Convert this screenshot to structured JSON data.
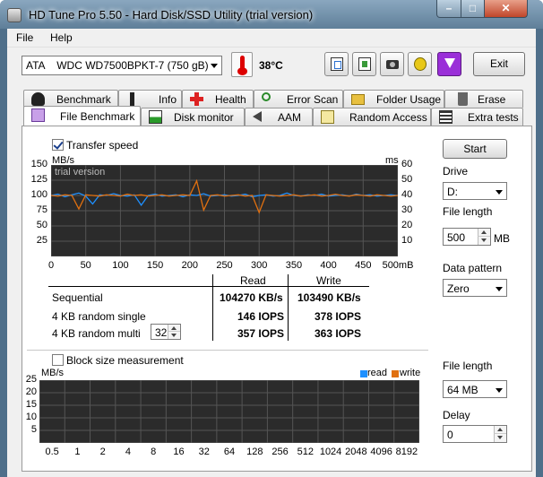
{
  "window": {
    "title": "HD Tune Pro 5.50 - Hard Disk/SSD Utility (trial version)"
  },
  "menu": [
    "File",
    "Help"
  ],
  "toolbar": {
    "drive": "ATA    WDC WD7500BPKT-7 (750 gB)",
    "temperature": "38°C",
    "exit_label": "Exit",
    "icons": [
      "copy-icon",
      "copy-all-icon",
      "camera-icon",
      "options-icon",
      "download-icon"
    ]
  },
  "tabs_row1": [
    "Benchmark",
    "Info",
    "Health",
    "Error Scan",
    "Folder Usage",
    "Erase"
  ],
  "tabs_row2": [
    "File Benchmark",
    "Disk monitor",
    "AAM",
    "Random Access",
    "Extra tests"
  ],
  "file_benchmark": {
    "transfer_speed_label": "Transfer speed",
    "transfer_speed_checked": true,
    "start_label": "Start",
    "drive_label": "Drive",
    "drive_value": "D:",
    "file_length_label": "File length",
    "file_length_value": "500",
    "file_length_unit": "MB",
    "data_pattern_label": "Data pattern",
    "data_pattern_value": "Zero",
    "results": {
      "col_read": "Read",
      "col_write": "Write",
      "rows": [
        {
          "label": "Sequential",
          "read": "104270 KB/s",
          "write": "103490 KB/s"
        },
        {
          "label": "4 KB random single",
          "read": "146 IOPS",
          "write": "378 IOPS"
        },
        {
          "label": "4 KB random multi",
          "read": "357 IOPS",
          "write": "363 IOPS"
        }
      ],
      "queue_depth": "32"
    },
    "block_size_label": "Block size measurement",
    "block_size_checked": false,
    "file_length2_label": "File length",
    "file_length2_value": "64 MB",
    "delay_label": "Delay",
    "delay_value": "0"
  },
  "chart_data": [
    {
      "type": "line",
      "watermark": "trial version",
      "ylabel_left": "MB/s",
      "ylabel_right": "ms",
      "ylim_left": [
        0,
        150
      ],
      "ylim_right": [
        0,
        60
      ],
      "yticks_left": [
        "150",
        "125",
        "100",
        "75",
        "50",
        "25"
      ],
      "yticks_right": [
        "60",
        "50",
        "40",
        "30",
        "20",
        "10"
      ],
      "xlim": [
        0,
        500
      ],
      "xticks": [
        "0",
        "50",
        "100",
        "150",
        "200",
        "250",
        "300",
        "350",
        "400",
        "450",
        "500mB"
      ],
      "grid": true,
      "series": [
        {
          "color": "#1e90ff",
          "x": [
            0,
            10,
            20,
            30,
            40,
            50,
            60,
            70,
            80,
            90,
            100,
            110,
            120,
            130,
            140,
            150,
            160,
            170,
            180,
            190,
            200,
            210,
            220,
            230,
            240,
            250,
            260,
            270,
            280,
            290,
            300,
            310,
            320,
            330,
            340,
            350,
            360,
            370,
            380,
            390,
            400,
            410,
            420,
            430,
            440,
            450,
            460,
            470,
            480,
            490,
            500
          ],
          "y": [
            100,
            102,
            98,
            101,
            104,
            99,
            86,
            101,
            100,
            103,
            100,
            99,
            101,
            84,
            100,
            102,
            99,
            100,
            101,
            98,
            101,
            100,
            103,
            99,
            100,
            101,
            99,
            100,
            102,
            98,
            100,
            101,
            99,
            100,
            104,
            100,
            99,
            101,
            100,
            102,
            99,
            100,
            101,
            99,
            102,
            100,
            101,
            99,
            100,
            101,
            100
          ]
        },
        {
          "color": "#e07010",
          "x": [
            0,
            10,
            20,
            30,
            40,
            50,
            60,
            70,
            80,
            90,
            100,
            110,
            120,
            130,
            140,
            150,
            160,
            170,
            180,
            190,
            200,
            210,
            220,
            230,
            240,
            250,
            260,
            270,
            280,
            290,
            300,
            310,
            320,
            330,
            340,
            350,
            360,
            370,
            380,
            390,
            400,
            410,
            420,
            430,
            440,
            450,
            460,
            470,
            480,
            490,
            500
          ],
          "y": [
            100,
            99,
            101,
            100,
            78,
            101,
            100,
            99,
            101,
            100,
            99,
            102,
            100,
            101,
            99,
            100,
            101,
            99,
            100,
            101,
            100,
            124,
            76,
            100,
            101,
            99,
            100,
            101,
            99,
            100,
            72,
            101,
            100,
            99,
            100,
            101,
            99,
            100,
            101,
            99,
            100,
            102,
            100,
            99,
            101,
            100,
            99,
            101,
            100,
            99,
            100
          ]
        }
      ]
    },
    {
      "type": "bar",
      "legend": [
        "read",
        "write"
      ],
      "legend_colors": [
        "#1e90ff",
        "#e07010"
      ],
      "legend_position": "top-right",
      "ylabel": "MB/s",
      "ylim": [
        0,
        25
      ],
      "yticks": [
        "25",
        "20",
        "15",
        "10",
        "5"
      ],
      "categories": [
        "0.5",
        "1",
        "2",
        "4",
        "8",
        "16",
        "32",
        "64",
        "128",
        "256",
        "512",
        "1024",
        "2048",
        "4096",
        "8192"
      ],
      "grid": true
    }
  ]
}
